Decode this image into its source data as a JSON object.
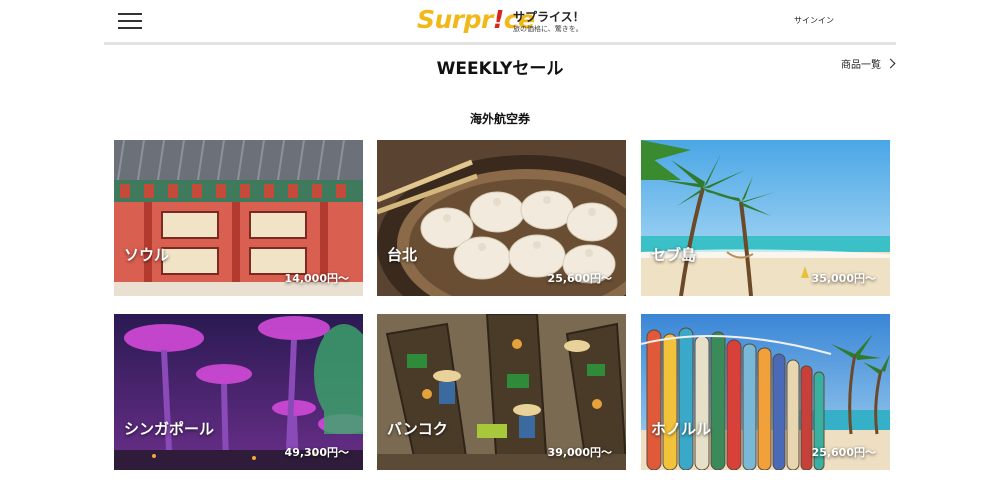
{
  "header": {
    "logo_main": "Surpr",
    "logo_bang": "!",
    "logo_end": "ce",
    "tagline_main": "サプライス！",
    "tagline_sub": "旅の価格に、驚きを。",
    "signin": "サインイン"
  },
  "section": {
    "title": "WEEKLYセール",
    "all_link": "商品一覧",
    "category": "海外航空券"
  },
  "deals": [
    {
      "city": "ソウル",
      "price": "14,000円〜"
    },
    {
      "city": "台北",
      "price": "25,600円〜"
    },
    {
      "city": "セブ島",
      "price": "35,000円〜"
    },
    {
      "city": "シンガポール",
      "price": "49,300円〜"
    },
    {
      "city": "バンコク",
      "price": "39,000円〜"
    },
    {
      "city": "ホノルル",
      "price": "25,600円〜"
    }
  ]
}
